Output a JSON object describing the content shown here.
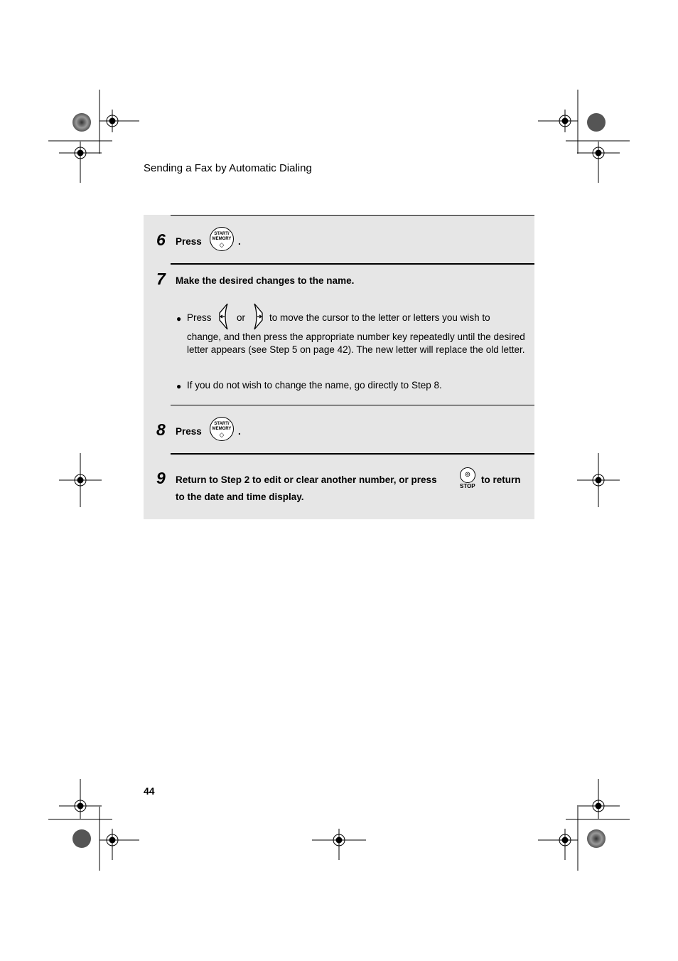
{
  "header": {
    "title": "Sending a Fax by Automatic Dialing"
  },
  "page_number": "44",
  "steps": [
    {
      "number": "6",
      "text": "Press",
      "suffix": ".",
      "button": {
        "line1": "START/",
        "line2": "MEMORY",
        "symbol": "◇"
      }
    },
    {
      "number": "7",
      "text": "Make the desired changes to the name.",
      "bullets": [
        {
          "press": "Press",
          "or": "or",
          "line1": "to move the cursor to the letter or letters you wish to",
          "rest": "change, and then press the appropriate number key repeatedly until the desired letter appears (see Step 5 on page 42). The new letter will replace the old letter."
        },
        {
          "text": "If you do not wish to change the name, go directly to Step 8."
        }
      ]
    },
    {
      "number": "8",
      "text": "Press",
      "suffix": ".",
      "button": {
        "line1": "START/",
        "line2": "MEMORY",
        "symbol": "◇"
      }
    },
    {
      "number": "9",
      "text_before": "Return to Step 2 to edit or clear another number, or press",
      "text_after": "to return",
      "text_line2": "to the date and time display.",
      "button": {
        "label": "STOP",
        "symbol": "⊚"
      }
    }
  ],
  "bullet_char": "●"
}
